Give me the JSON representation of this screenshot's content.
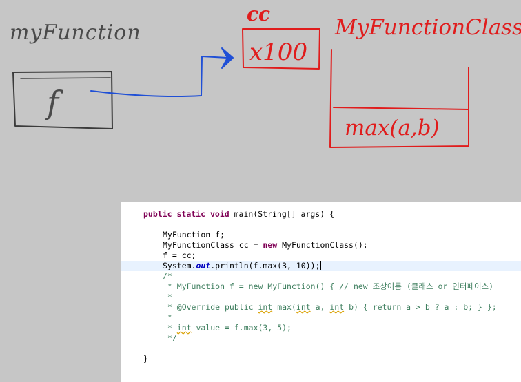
{
  "diagram": {
    "labels": {
      "my_function": "myFunction",
      "f": "f",
      "cc": "cc",
      "x100": "x100",
      "my_function_class": "MyFunctionClass",
      "max_method": "max(a,b)"
    },
    "colors": {
      "background": "#c6c6c6",
      "ink_gray": "#4a4a4a",
      "ink_red": "#e01c1c",
      "ink_blue": "#1f4fd6"
    }
  },
  "code": {
    "line1": {
      "t1": "public",
      "t2": " ",
      "t3": "static",
      "t4": " ",
      "t5": "void",
      "t6": " main(String[] args) {"
    },
    "line2": {
      "t1": "MyFunction f;"
    },
    "line3": {
      "t1": "MyFunctionClass cc = ",
      "t2": "new",
      "t3": " MyFunctionClass();"
    },
    "line4": {
      "t1": "f = cc;"
    },
    "line5": {
      "t1": "System.",
      "t2": "out",
      "t3": ".println(f.max(3, 10));"
    },
    "comment1": "/*",
    "comment2": " * MyFunction f = new MyFunction() { // new 조상이름 (클래스 or 인터페이스)",
    "comment3": " *",
    "comment4": {
      "t1": " * @Override public ",
      "t2": "int",
      "t3": " max(",
      "t4": "int",
      "t5": " a, ",
      "t6": "int",
      "t7": " b) { return a > b ? a : b; } };"
    },
    "comment5": " *",
    "comment6": {
      "t1": " * ",
      "t2": "int",
      "t3": " value = f.max(3, 5);"
    },
    "comment7": " */",
    "closing": "}"
  }
}
